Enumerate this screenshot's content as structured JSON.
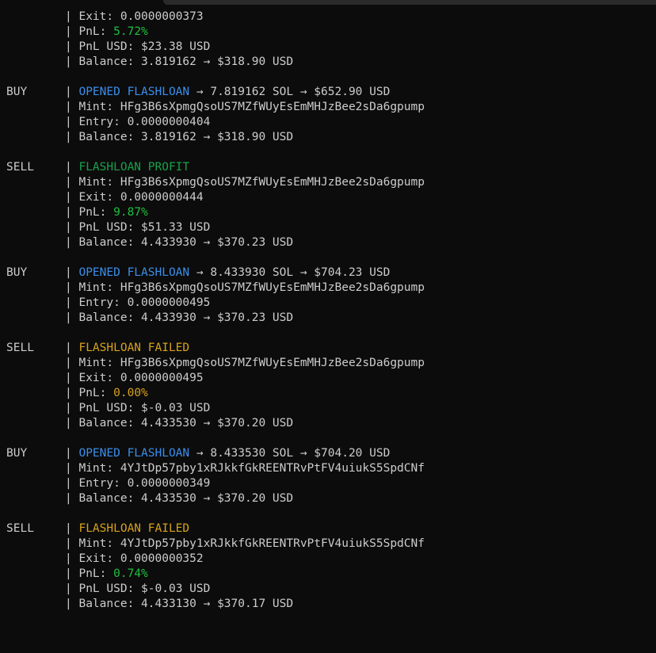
{
  "separator": "| ",
  "arrow": "→",
  "blocks": [
    {
      "side": "",
      "lines": [
        {
          "label": "Exit: ",
          "value": "0.0000000373"
        },
        {
          "label": "PnL: ",
          "value": "5.72%",
          "tone": "green"
        },
        {
          "label": "PnL USD: ",
          "value": "$23.38 USD"
        },
        {
          "label": "Balance: ",
          "value": "3.819162 → $318.90 USD"
        }
      ]
    },
    {
      "side": "BUY",
      "header": {
        "text": "OPENED FLASHLOAN",
        "tone": "blue",
        "suffix": " → 7.819162 SOL → $652.90 USD"
      },
      "lines": [
        {
          "label": "Mint: ",
          "value": "HFg3B6sXpmgQsoUS7MZfWUyEsEmMHJzBee2sDa6gpump"
        },
        {
          "label": "Entry: ",
          "value": "0.0000000404"
        },
        {
          "label": "Balance: ",
          "value": "3.819162 → $318.90 USD"
        }
      ]
    },
    {
      "side": "SELL",
      "header": {
        "text": "FLASHLOAN PROFIT",
        "tone": "green",
        "suffix": ""
      },
      "lines": [
        {
          "label": "Mint: ",
          "value": "HFg3B6sXpmgQsoUS7MZfWUyEsEmMHJzBee2sDa6gpump"
        },
        {
          "label": "Exit: ",
          "value": "0.0000000444"
        },
        {
          "label": "PnL: ",
          "value": "9.87%",
          "tone": "green"
        },
        {
          "label": "PnL USD: ",
          "value": "$51.33 USD"
        },
        {
          "label": "Balance: ",
          "value": "4.433930 → $370.23 USD"
        }
      ]
    },
    {
      "side": "BUY",
      "header": {
        "text": "OPENED FLASHLOAN",
        "tone": "blue",
        "suffix": " → 8.433930 SOL → $704.23 USD"
      },
      "lines": [
        {
          "label": "Mint: ",
          "value": "HFg3B6sXpmgQsoUS7MZfWUyEsEmMHJzBee2sDa6gpump"
        },
        {
          "label": "Entry: ",
          "value": "0.0000000495"
        },
        {
          "label": "Balance: ",
          "value": "4.433930 → $370.23 USD"
        }
      ]
    },
    {
      "side": "SELL",
      "header": {
        "text": "FLASHLOAN FAILED",
        "tone": "gold",
        "suffix": ""
      },
      "lines": [
        {
          "label": "Mint: ",
          "value": "HFg3B6sXpmgQsoUS7MZfWUyEsEmMHJzBee2sDa6gpump"
        },
        {
          "label": "Exit: ",
          "value": "0.0000000495"
        },
        {
          "label": "PnL: ",
          "value": "0.00%",
          "tone": "gold"
        },
        {
          "label": "PnL USD: ",
          "value": "$-0.03 USD"
        },
        {
          "label": "Balance: ",
          "value": "4.433530 → $370.20 USD"
        }
      ]
    },
    {
      "side": "BUY",
      "header": {
        "text": "OPENED FLASHLOAN",
        "tone": "blue",
        "suffix": " → 8.433530 SOL → $704.20 USD"
      },
      "lines": [
        {
          "label": "Mint: ",
          "value": "4YJtDp57pby1xRJkkfGkREENTRvPtFV4uiukS5SpdCNf"
        },
        {
          "label": "Entry: ",
          "value": "0.0000000349"
        },
        {
          "label": "Balance: ",
          "value": "4.433530 → $370.20 USD"
        }
      ]
    },
    {
      "side": "SELL",
      "header": {
        "text": "FLASHLOAN FAILED",
        "tone": "gold",
        "suffix": ""
      },
      "lines": [
        {
          "label": "Mint: ",
          "value": "4YJtDp57pby1xRJkkfGkREENTRvPtFV4uiukS5SpdCNf"
        },
        {
          "label": "Exit: ",
          "value": "0.0000000352"
        },
        {
          "label": "PnL: ",
          "value": "0.74%",
          "tone": "green"
        },
        {
          "label": "PnL USD: ",
          "value": "$-0.03 USD"
        },
        {
          "label": "Balance: ",
          "value": "4.433130 → $370.17 USD"
        }
      ]
    }
  ],
  "colors": {
    "background": "#0c0c0c",
    "text": "#cccccc",
    "blue": "#3b8eea",
    "green": "#1fbf3f",
    "gold": "#d7a21c"
  }
}
